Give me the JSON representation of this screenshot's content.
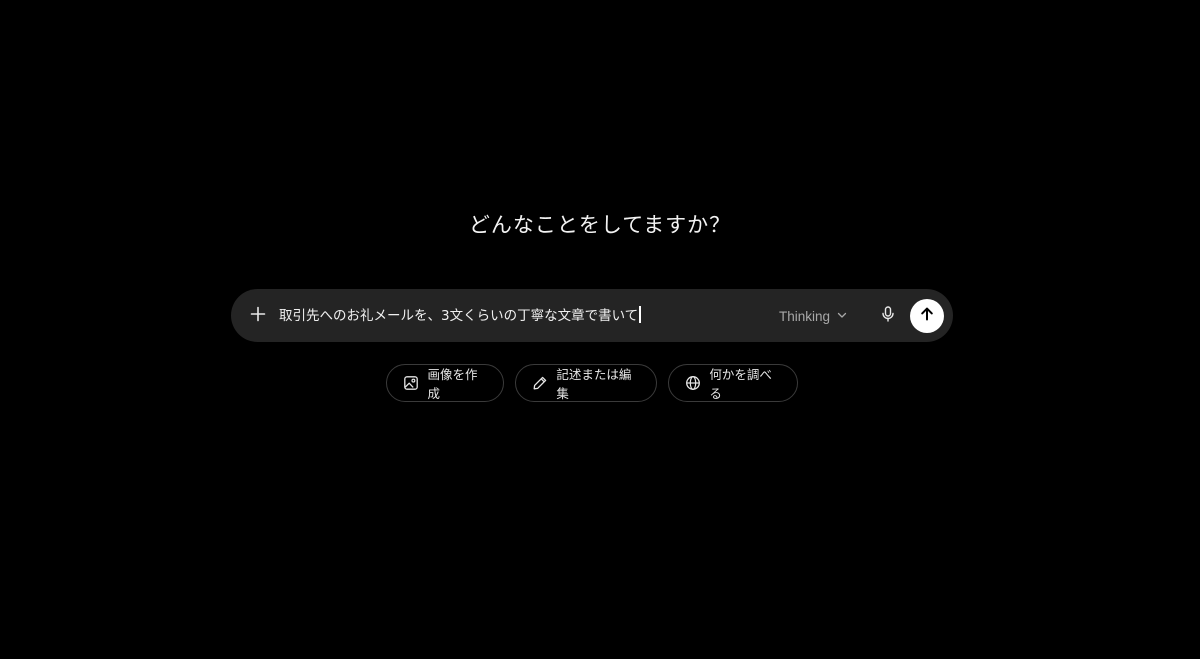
{
  "main": {
    "heading": "どんなことをしてますか？"
  },
  "composer": {
    "input_value": "取引先へのお礼メールを、3文くらいの丁寧な文章で書いて",
    "plus_icon": "plus-icon",
    "model_label": "Thinking",
    "model_icon": "chevron-down-icon",
    "mic_icon": "microphone-icon",
    "send_icon": "arrow-up-icon"
  },
  "suggestions": [
    {
      "label": "画像を作成",
      "icon": "image-icon"
    },
    {
      "label": "記述または編集",
      "icon": "pencil-icon"
    },
    {
      "label": "何かを調べる",
      "icon": "globe-icon"
    }
  ],
  "colors": {
    "background": "#000000",
    "composer_bg": "#242424",
    "send_button_bg": "#ffffff",
    "chip_border": "#3a3a3a",
    "muted_text": "#a8a8a8"
  }
}
